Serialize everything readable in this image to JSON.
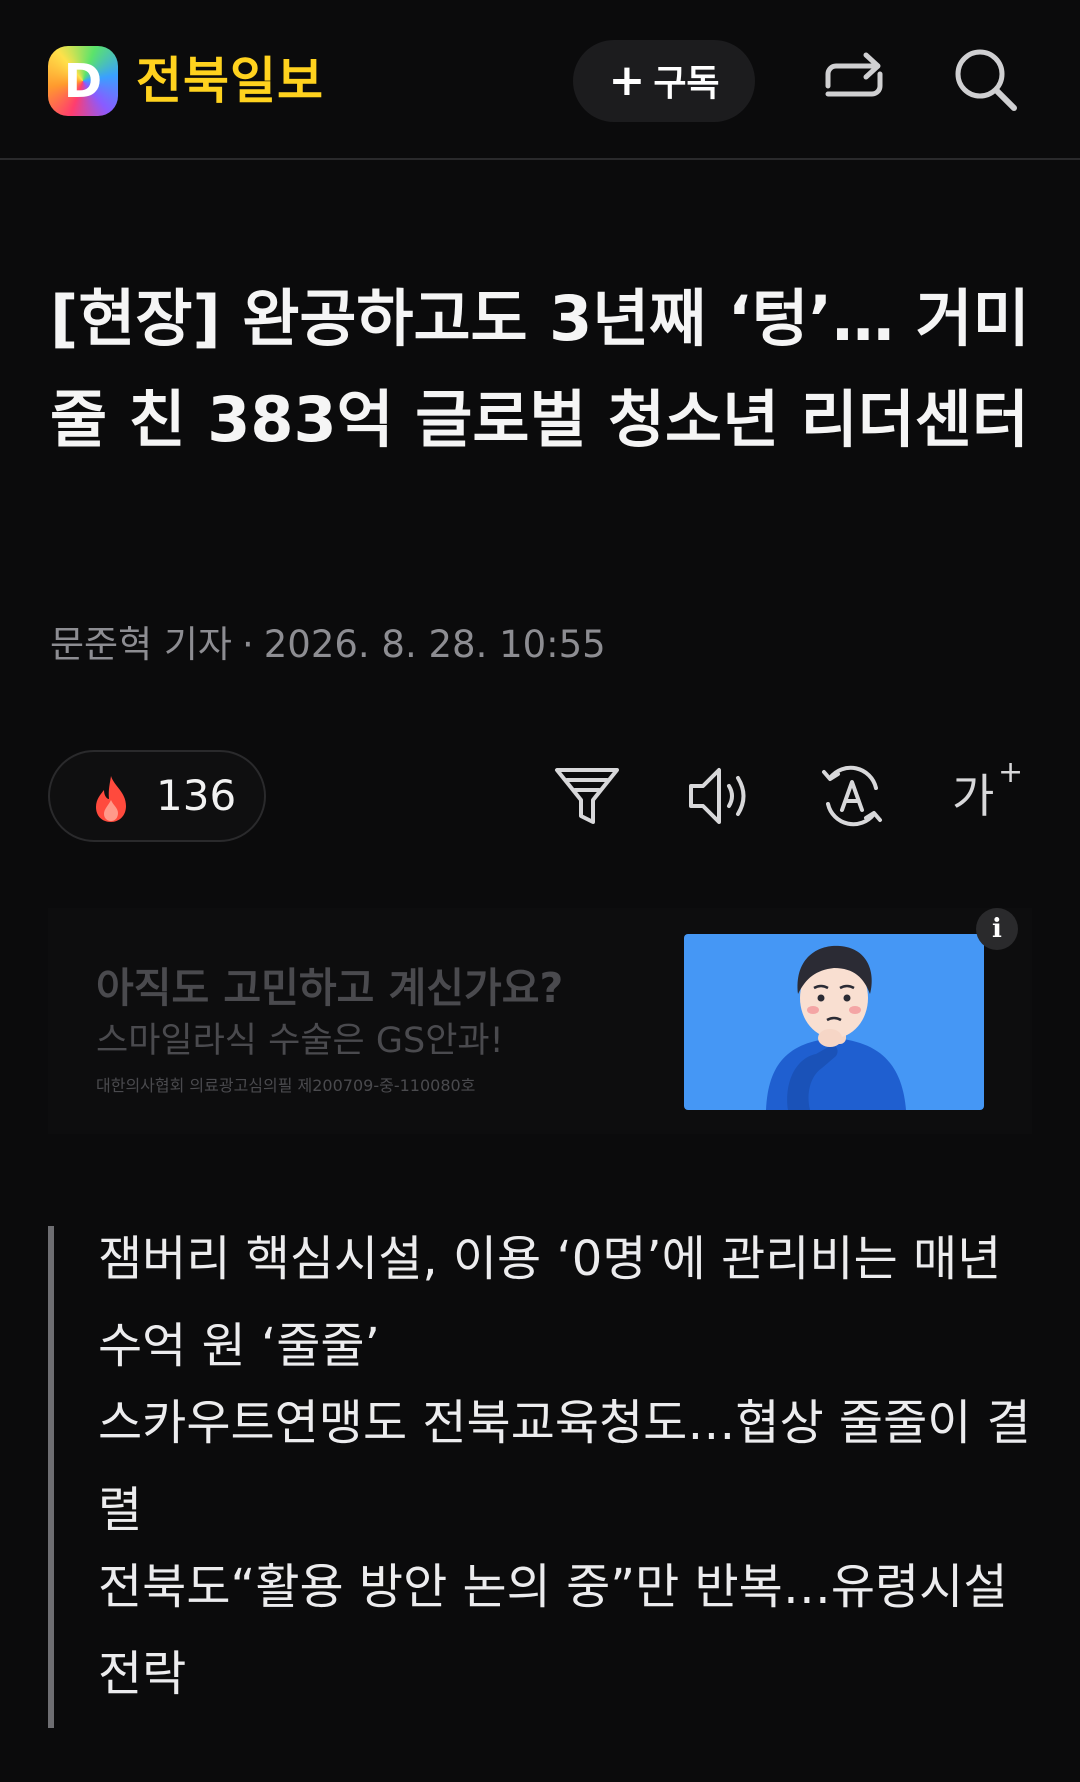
{
  "header": {
    "logo_letter": "D",
    "brand": "전북일보",
    "subscribe_plus": "+",
    "subscribe_label": "구독"
  },
  "article": {
    "headline": "[현장] 완공하고도 3년째 ‘텅’… 거미줄 친 383억 글로벌 청소년 리더센터",
    "author": "문준혁 기자",
    "separator": "·",
    "datetime": "2026. 8. 28. 10:55"
  },
  "toolbar": {
    "reaction_count": "136",
    "fontsize_label": "가",
    "fontsize_plus": "+"
  },
  "ad": {
    "title": "아직도 고민하고 계신가요?",
    "subtitle": "스마일라식 수술은 GS안과!",
    "legal": "대한의사협회 의료광고심의필 제200709-중-110080호",
    "info": "i"
  },
  "summary": {
    "lines": [
      "잼버리 핵심시설, 이용 ‘0명’에 관리비는 매년 수억 원 ‘줄줄’",
      "스카우트연맹도 전북교육청도…협상 줄줄이 결렬",
      "전북도“활용 방안 논의 중”만 반복…유령시설 전락"
    ]
  },
  "colors": {
    "background": "#0b0b0c",
    "brand": "#ffd21e",
    "ad_image_bg": "#4597f5",
    "fire": "#ff4a3d"
  },
  "icons": [
    "logo-icon",
    "share-icon",
    "search-icon",
    "fire-icon",
    "filter-icon",
    "speaker-icon",
    "translate-icon",
    "font-size-icon",
    "info-icon"
  ]
}
